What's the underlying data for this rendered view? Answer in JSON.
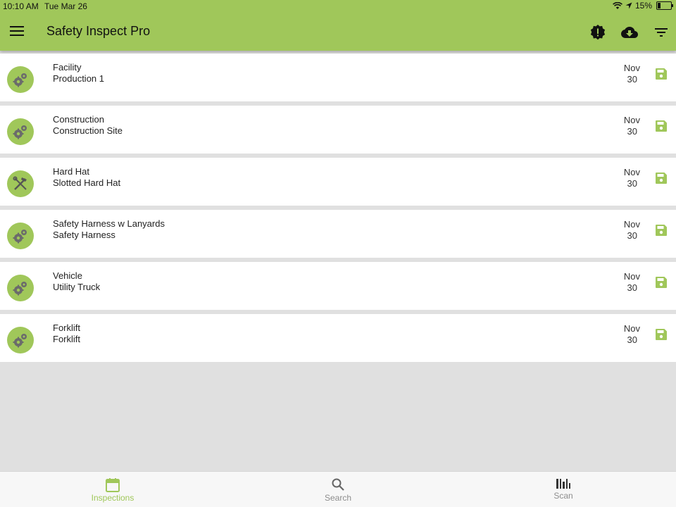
{
  "status_bar": {
    "time": "10:10 AM",
    "date": "Tue Mar 26",
    "battery": "15%"
  },
  "app_bar": {
    "title": "Safety Inspect Pro",
    "menu_icon": "hamburger-icon",
    "action_icons": [
      "alert-badge-icon",
      "cloud-download-icon",
      "filter-icon"
    ]
  },
  "colors": {
    "accent": "#a0c75a",
    "background": "#e0e0e0"
  },
  "inspections": [
    {
      "title": "Facility",
      "subtitle": "Production 1",
      "month": "Nov",
      "day": "30",
      "icon": "gears-icon"
    },
    {
      "title": "Construction",
      "subtitle": "Construction Site",
      "month": "Nov",
      "day": "30",
      "icon": "gears-icon"
    },
    {
      "title": "Hard Hat",
      "subtitle": "Slotted Hard Hat",
      "month": "Nov",
      "day": "30",
      "icon": "tools-icon"
    },
    {
      "title": "Safety Harness w Lanyards",
      "subtitle": "Safety Harness",
      "month": "Nov",
      "day": "30",
      "icon": "gears-icon"
    },
    {
      "title": "Vehicle",
      "subtitle": "Utility Truck",
      "month": "Nov",
      "day": "30",
      "icon": "gears-icon"
    },
    {
      "title": "Forklift",
      "subtitle": "Forklift",
      "month": "Nov",
      "day": "30",
      "icon": "gears-icon"
    }
  ],
  "tabs": [
    {
      "label": "Inspections",
      "icon": "calendar-icon",
      "active": true
    },
    {
      "label": "Search",
      "icon": "search-icon",
      "active": false
    },
    {
      "label": "Scan",
      "icon": "scan-icon",
      "active": false
    }
  ]
}
